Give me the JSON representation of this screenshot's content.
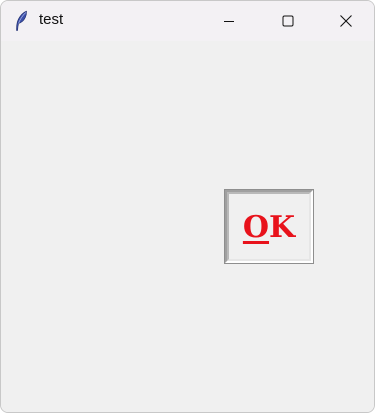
{
  "window": {
    "title": "test",
    "app_icon": "feather-icon",
    "controls": {
      "minimize_icon": "minimize-icon",
      "maximize_icon": "maximize-icon",
      "close_icon": "close-icon"
    }
  },
  "ok_button": {
    "mnemonic": "O",
    "rest": "K",
    "color": "#e8121b"
  },
  "colors": {
    "titlebar": "#f3f1f4",
    "client_bg": "#f0f0f0"
  }
}
